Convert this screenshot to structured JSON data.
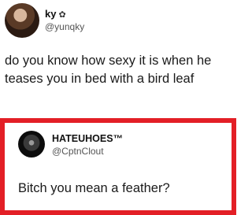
{
  "tweet": {
    "display_name": "ky",
    "badge_icon": "flower-icon",
    "badge_glyph": "✿",
    "handle": "@yunqky",
    "text": "do you know how sexy it is when he teases you in bed with a bird leaf"
  },
  "quote": {
    "border_color": "#e31f26",
    "display_name": "HATEUHOES™",
    "handle": "@CptnClout",
    "text": "Bitch you mean a feather?"
  }
}
